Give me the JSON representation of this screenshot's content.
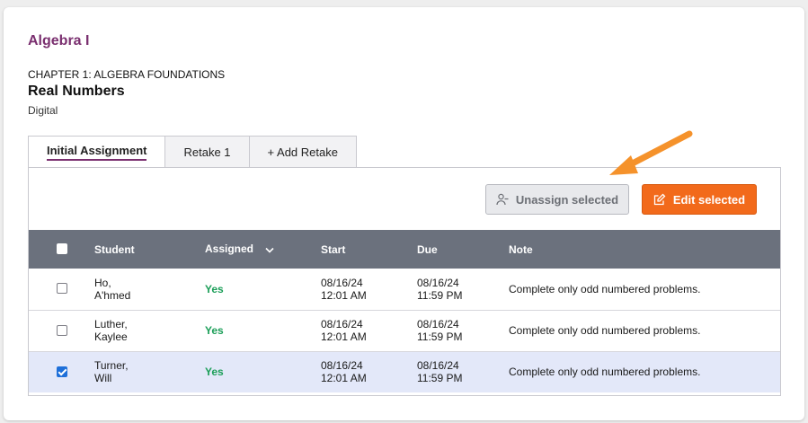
{
  "course": {
    "title": "Algebra I"
  },
  "lesson": {
    "chapter": "CHAPTER 1: ALGEBRA FOUNDATIONS",
    "title": "Real Numbers",
    "format": "Digital"
  },
  "tabs": [
    {
      "label": "Initial Assignment",
      "active": true
    },
    {
      "label": "Retake 1",
      "active": false
    },
    {
      "label": "+ Add Retake",
      "active": false
    }
  ],
  "toolbar": {
    "unassign_label": "Unassign selected",
    "edit_label": "Edit selected"
  },
  "table": {
    "headers": {
      "student": "Student",
      "assigned": "Assigned",
      "start": "Start",
      "due": "Due",
      "note": "Note"
    },
    "rows": [
      {
        "last": "Ho,",
        "first": "A'hmed",
        "assigned": "Yes",
        "start_date": "08/16/24",
        "start_time": "12:01 AM",
        "due_date": "08/16/24",
        "due_time": "11:59 PM",
        "note": "Complete only odd numbered problems.",
        "selected": false
      },
      {
        "last": "Luther,",
        "first": "Kaylee",
        "assigned": "Yes",
        "start_date": "08/16/24",
        "start_time": "12:01 AM",
        "due_date": "08/16/24",
        "due_time": "11:59 PM",
        "note": "Complete only odd numbered problems.",
        "selected": false
      },
      {
        "last": "Turner,",
        "first": "Will",
        "assigned": "Yes",
        "start_date": "08/16/24",
        "start_time": "12:01 AM",
        "due_date": "08/16/24",
        "due_time": "11:59 PM",
        "note": "Complete only odd numbered problems.",
        "selected": true
      }
    ]
  },
  "colors": {
    "brand": "#7a2f6f",
    "accent_orange": "#f26a1b",
    "header_bg": "#6b717d",
    "selected_row": "#e3e8f9",
    "yes_green": "#1b9e58",
    "annotation_arrow": "#f5922b"
  },
  "icons": {
    "unassign": "user-minus-icon",
    "edit": "edit-icon",
    "sort": "chevron-down-icon"
  }
}
